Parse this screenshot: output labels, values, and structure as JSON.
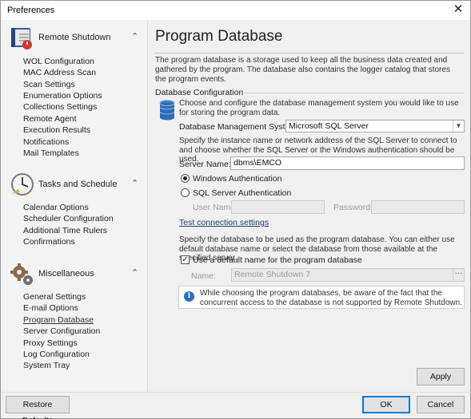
{
  "window": {
    "title": "Preferences",
    "close_glyph": "✕"
  },
  "sidebar": {
    "groups": [
      {
        "label": "Remote Shutdown",
        "icon": "book-icon",
        "items": [
          "WOL Configuration",
          "MAC Address Scan",
          "Scan Settings",
          "Enumeration Options",
          "Collections Settings",
          "Remote Agent",
          "Execution Results",
          "Notifications",
          "Mail Templates"
        ]
      },
      {
        "label": "Tasks and Schedule",
        "icon": "clock-icon",
        "items": [
          "Calendar Options",
          "Scheduler Configuration",
          "Additional Time Rulers",
          "Confirmations"
        ]
      },
      {
        "label": "Miscellaneous",
        "icon": "gears-icon",
        "items": [
          "General Settings",
          "E-mail Options",
          "Program Database",
          "Server Configuration",
          "Proxy Settings",
          "Log Configuration",
          "System Tray"
        ]
      }
    ],
    "chevron": "⌃",
    "active_item": "Program Database"
  },
  "main": {
    "title": "Program Database",
    "description": "The program database is a storage used to keep all the business data created and gathered by the program. The database also contains the logger catalog that stores the program events.",
    "section_label": "Database Configuration",
    "choose_text": "Choose and configure the database management system you would like to use for storing the program data.",
    "dbms_label": "Database Management System:",
    "dbms_value": "Microsoft SQL Server",
    "instance_text": "Specify the instance name or network address of the SQL Server to connect to and choose whether the SQL Server or the Windows authentication should be used.",
    "server_label": "Server Name:",
    "server_value": "dbms\\EMCO",
    "auth_windows": "Windows Authentication",
    "auth_sql": "SQL Server Authentication",
    "username_label": "User Name:",
    "password_label": "Password:",
    "test_link": "Test connection settings",
    "db_text": "Specify the database to be used as the program database. You can either use default database name or select the database from those available at the specified server.",
    "default_name_label": "Use a default name for the program database",
    "name_label": "Name:",
    "name_value": "Remote Shutdown 7",
    "browse_glyph": "···",
    "info_icon_glyph": "i",
    "info_text": "While choosing the program databases, be aware of the fact that the concurrent access to the database is not supported by Remote Shutdown."
  },
  "buttons": {
    "apply": "Apply",
    "restore": "Restore Defaults",
    "ok": "OK",
    "cancel": "Cancel"
  },
  "colors": {
    "accent": "#0078d7",
    "link": "#1a3e7a",
    "info": "#2b6cc4"
  }
}
